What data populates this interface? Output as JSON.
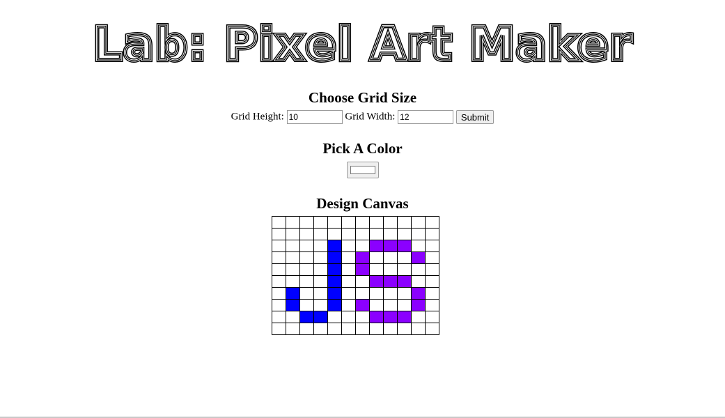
{
  "logo": {
    "text": "Lab: Pixel Art Maker"
  },
  "grid_size": {
    "heading": "Choose Grid Size",
    "height_label": "Grid Height:",
    "height_value": "10",
    "width_label": "Grid Width:",
    "width_value": "12",
    "submit_label": "Submit"
  },
  "color_picker": {
    "heading": "Pick A Color",
    "value": "#ffffff"
  },
  "canvas": {
    "heading": "Design Canvas",
    "rows": 10,
    "cols": 12,
    "palette": {
      "1": "#0000ff",
      "2": "#8b00ff"
    },
    "cells": [
      [
        0,
        0,
        0,
        0,
        0,
        0,
        0,
        0,
        0,
        0,
        0,
        0
      ],
      [
        0,
        0,
        0,
        0,
        0,
        0,
        0,
        0,
        0,
        0,
        0,
        0
      ],
      [
        0,
        0,
        0,
        0,
        1,
        0,
        0,
        2,
        2,
        2,
        0,
        0
      ],
      [
        0,
        0,
        0,
        0,
        1,
        0,
        2,
        0,
        0,
        0,
        2,
        0
      ],
      [
        0,
        0,
        0,
        0,
        1,
        0,
        2,
        0,
        0,
        0,
        0,
        0
      ],
      [
        0,
        0,
        0,
        0,
        1,
        0,
        0,
        2,
        2,
        2,
        0,
        0
      ],
      [
        0,
        1,
        0,
        0,
        1,
        0,
        0,
        0,
        0,
        0,
        2,
        0
      ],
      [
        0,
        1,
        0,
        0,
        1,
        0,
        2,
        0,
        0,
        0,
        2,
        0
      ],
      [
        0,
        0,
        1,
        1,
        0,
        0,
        0,
        2,
        2,
        2,
        0,
        0
      ],
      [
        0,
        0,
        0,
        0,
        0,
        0,
        0,
        0,
        0,
        0,
        0,
        0
      ]
    ]
  }
}
